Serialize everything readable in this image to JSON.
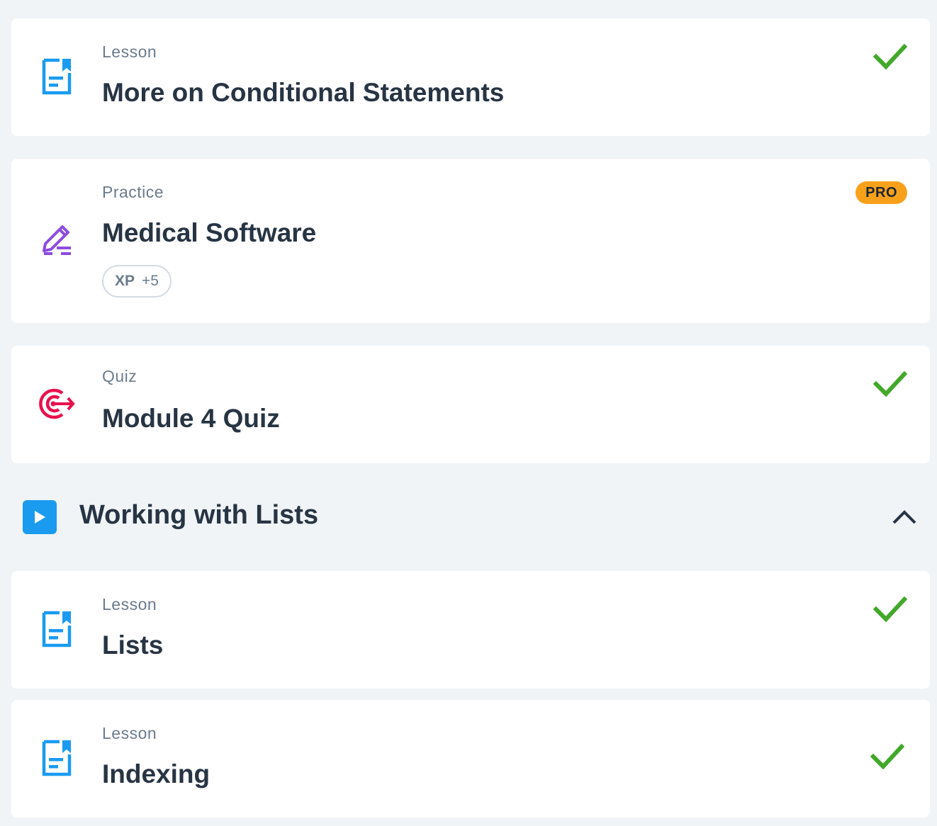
{
  "items_before": [
    {
      "kind": "Lesson",
      "title": "More on Conditional Statements",
      "icon": "lesson-icon",
      "completed": true
    },
    {
      "kind": "Practice",
      "title": "Medical Software",
      "icon": "practice-pencil-icon",
      "badge": "PRO",
      "xp_label": "XP",
      "xp_value": "+5"
    },
    {
      "kind": "Quiz",
      "title": "Module 4 Quiz",
      "icon": "quiz-target-icon",
      "completed": true
    }
  ],
  "section": {
    "title": "Working with Lists",
    "icon": "play-icon",
    "expanded": true
  },
  "items_after": [
    {
      "kind": "Lesson",
      "title": "Lists",
      "icon": "lesson-icon",
      "completed": true
    },
    {
      "kind": "Lesson",
      "title": "Indexing",
      "icon": "lesson-icon",
      "completed": true
    }
  ],
  "colors": {
    "background": "#f0f4f7",
    "lesson_blue": "#1a9bf0",
    "practice_purple": "#8e4be0",
    "quiz_red": "#e8114d",
    "check_green": "#42a82a",
    "pro_orange": "#f7a11b",
    "text_dark": "#273443",
    "text_muted": "#6b7b8c"
  }
}
